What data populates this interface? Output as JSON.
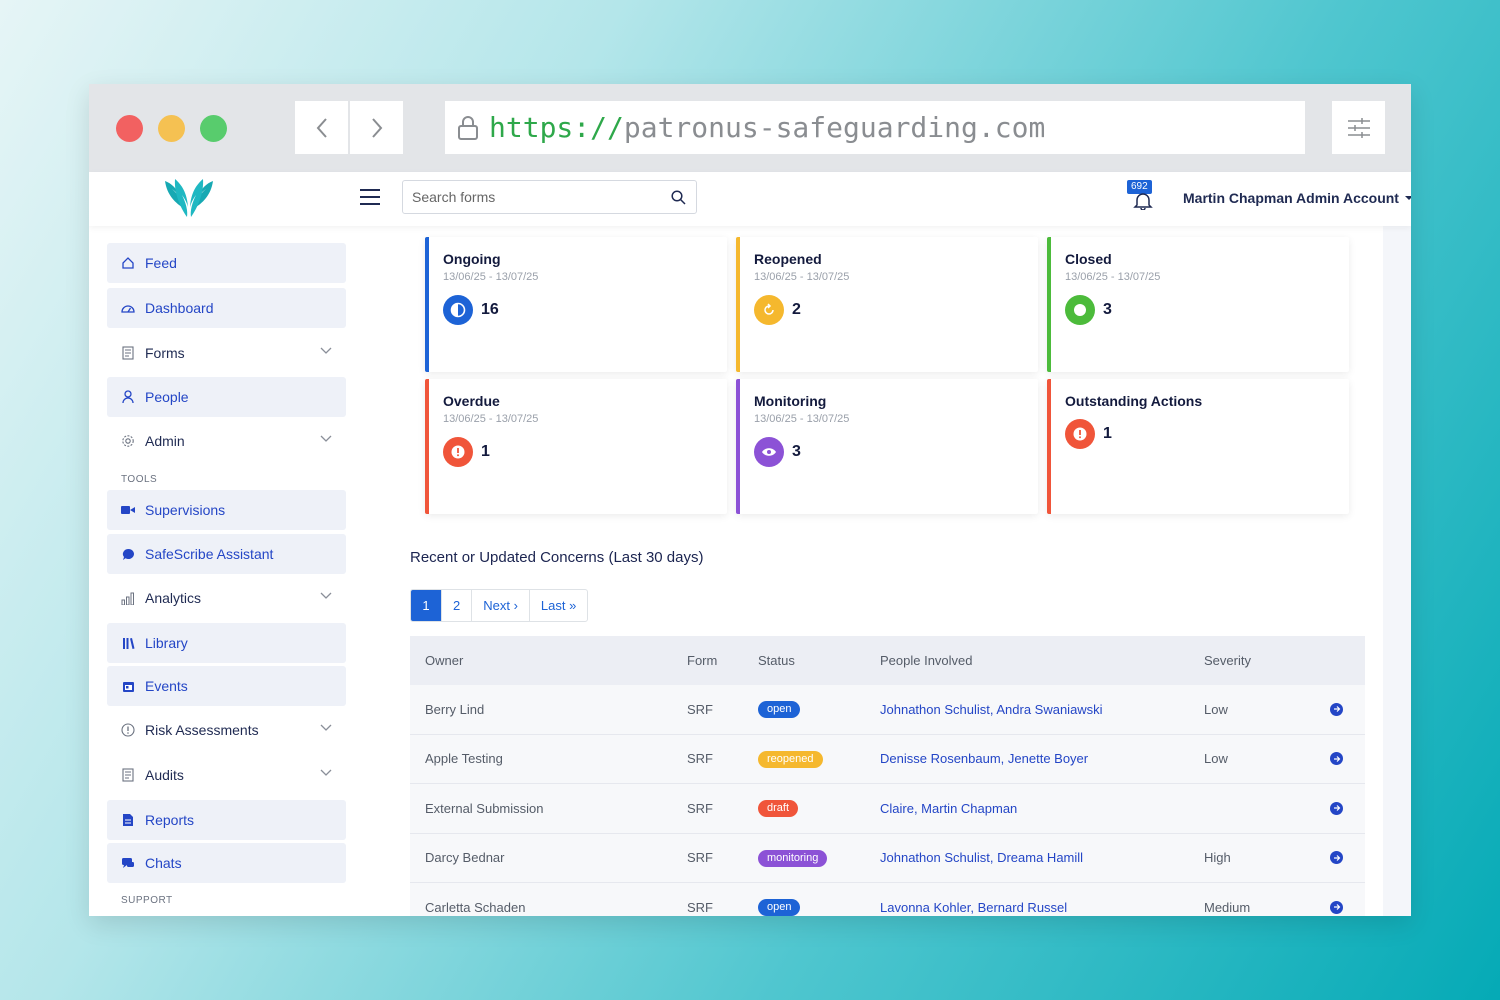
{
  "browser": {
    "url_scheme": "https://",
    "url_host": "patronus-safeguarding.com"
  },
  "header": {
    "search_placeholder": "Search forms",
    "notification_count": "692",
    "account_name": "Martin Chapman Admin Account"
  },
  "sidebar": {
    "items": [
      {
        "label": "Feed",
        "icon": "home-icon"
      },
      {
        "label": "Dashboard",
        "icon": "dashboard-icon"
      },
      {
        "label": "Forms",
        "icon": "forms-icon"
      },
      {
        "label": "People",
        "icon": "person-icon"
      },
      {
        "label": "Admin",
        "icon": "gear-icon"
      },
      {
        "label": "Supervisions",
        "icon": "video-icon"
      },
      {
        "label": "SafeScribe Assistant",
        "icon": "chat-bubble-icon"
      },
      {
        "label": "Analytics",
        "icon": "bar-chart-icon"
      },
      {
        "label": "Library",
        "icon": "library-icon"
      },
      {
        "label": "Events",
        "icon": "calendar-icon"
      },
      {
        "label": "Risk Assessments",
        "icon": "alert-circle-icon"
      },
      {
        "label": "Audits",
        "icon": "audit-icon"
      },
      {
        "label": "Reports",
        "icon": "report-icon"
      },
      {
        "label": "Chats",
        "icon": "chats-icon"
      }
    ],
    "tools_label": "TOOLS",
    "support_label": "SUPPORT"
  },
  "cards": [
    {
      "title": "Ongoing",
      "date": "13/06/25 - 13/07/25",
      "value": "16",
      "color": "#1d63d6"
    },
    {
      "title": "Reopened",
      "date": "13/06/25 - 13/07/25",
      "value": "2",
      "color": "#f5b82e"
    },
    {
      "title": "Closed",
      "date": "13/06/25 - 13/07/25",
      "value": "3",
      "color": "#4cbb3b"
    },
    {
      "title": "Overdue",
      "date": "13/06/25 - 13/07/25",
      "value": "1",
      "color": "#f0553a"
    },
    {
      "title": "Monitoring",
      "date": "13/06/25 - 13/07/25",
      "value": "3",
      "color": "#8c52d6"
    },
    {
      "title": "Outstanding Actions",
      "date": "",
      "value": "1",
      "color": "#f0553a"
    }
  ],
  "concerns": {
    "title": "Recent or Updated Concerns (Last 30 days)",
    "pager": [
      "1",
      "2",
      "Next ›",
      "Last »"
    ],
    "columns": [
      "Owner",
      "Form",
      "Status",
      "People Involved",
      "Severity"
    ],
    "rows": [
      {
        "owner": "Berry Lind",
        "form": "SRF",
        "status": "open",
        "status_color": "#1d63d6",
        "people": "Johnathon Schulist, Andra Swaniawski",
        "severity": "Low"
      },
      {
        "owner": "Apple Testing",
        "form": "SRF",
        "status": "reopened",
        "status_color": "#f5b82e",
        "people": "Denisse Rosenbaum, Jenette Boyer",
        "severity": "Low"
      },
      {
        "owner": "External Submission",
        "form": "SRF",
        "status": "draft",
        "status_color": "#f0553a",
        "people": "Claire, Martin Chapman",
        "severity": ""
      },
      {
        "owner": "Darcy Bednar",
        "form": "SRF",
        "status": "monitoring",
        "status_color": "#8c52d6",
        "people": "Johnathon Schulist, Dreama Hamill",
        "severity": "High"
      },
      {
        "owner": "Carletta Schaden",
        "form": "SRF",
        "status": "open",
        "status_color": "#1d63d6",
        "people": "Lavonna Kohler, Bernard Russel",
        "severity": "Medium"
      }
    ]
  }
}
